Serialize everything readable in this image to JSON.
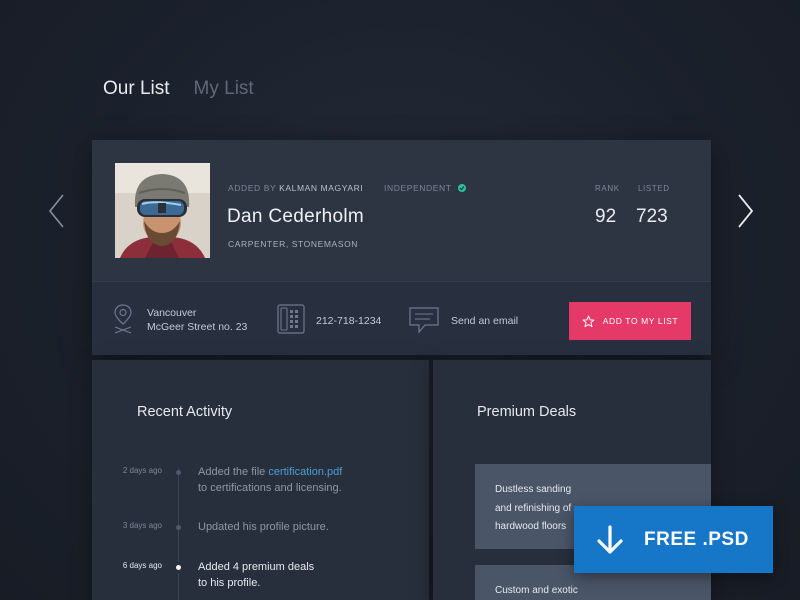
{
  "tabs": [
    {
      "label": "Our List",
      "active": true
    },
    {
      "label": "My List",
      "active": false
    }
  ],
  "profile": {
    "added_by_prefix": "ADDED BY",
    "added_by_name": "KALMAN MAGYARI",
    "status": "INDEPENDENT",
    "name": "Dan Cederholm",
    "profession": "CARPENTER,  STONEMASON",
    "rank_label": "RANK",
    "rank_value": "92",
    "listed_label": "LISTED",
    "listed_value": "723"
  },
  "contact": {
    "city": "Vancouver",
    "street": "McGeer Street no. 23",
    "phone": "212-718-1234",
    "email_label": "Send an email",
    "add_button": "ADD TO MY LIST"
  },
  "activity": {
    "title": "Recent Activity",
    "items": [
      {
        "date": "2 days ago",
        "text_before": "Added the file ",
        "link": "certification.pdf",
        "text_after": "to certifications and licensing."
      },
      {
        "date": "3 days ago",
        "text": "Updated his profile picture."
      },
      {
        "date": "6 days ago",
        "text": "Added 4 premium deals",
        "text2": "to his profile."
      }
    ]
  },
  "deals": {
    "title": "Premium Deals",
    "items": [
      {
        "line1": "Dustless sanding",
        "line2": "and refinishing of",
        "line3": "hardwood floors"
      },
      {
        "line1": "Custom and exotic"
      }
    ]
  },
  "badge": {
    "label": "FREE .PSD"
  },
  "colors": {
    "accent_pink": "#e53a68",
    "badge_blue": "#1676c7",
    "link_blue": "#4b9fd6",
    "verified_green": "#2bbfa3"
  },
  "icons": [
    "chevron-left-icon",
    "chevron-right-icon",
    "location-pin-icon",
    "phone-icon",
    "chat-icon",
    "star-icon",
    "verified-icon",
    "download-arrow-icon"
  ]
}
